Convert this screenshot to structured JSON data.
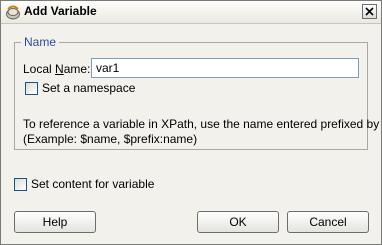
{
  "window": {
    "title": "Add Variable",
    "close_icon": "close-icon"
  },
  "group": {
    "legend": "Name"
  },
  "local_name": {
    "label_pre": "Local ",
    "label_mnemonic": "N",
    "label_post": "ame:",
    "value": "var1"
  },
  "namespace_checkbox": {
    "label": "Set a namespace",
    "checked": false
  },
  "help_text": {
    "line1": "To reference a variable in XPath, use the name entered prefixed by $",
    "line2": "(Example: $name, $prefix:name)"
  },
  "content_checkbox": {
    "label": "Set content for variable",
    "checked": false
  },
  "buttons": {
    "help": "Help",
    "ok": "OK",
    "cancel": "Cancel"
  }
}
